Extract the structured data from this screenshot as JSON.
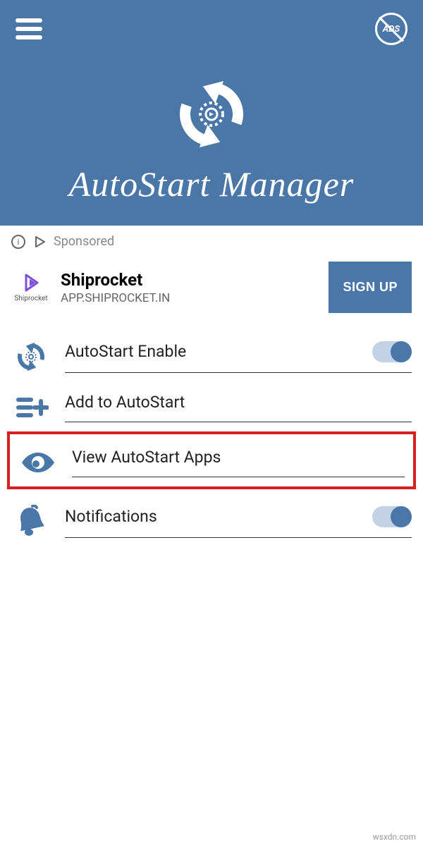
{
  "header": {
    "app_title": "AutoStart Manager",
    "ads_badge": "ADS"
  },
  "sponsored": {
    "label": "Sponsored"
  },
  "ad": {
    "title": "Shiprocket",
    "url": "APP.SHIPROCKET.IN",
    "icon_label": "Shiprocket",
    "cta": "SIGN UP"
  },
  "menu": {
    "items": [
      {
        "label": "AutoStart Enable",
        "toggle": true,
        "toggle_on": true,
        "icon": "refresh-gear"
      },
      {
        "label": "Add to AutoStart",
        "toggle": false,
        "icon": "list-plus"
      },
      {
        "label": "View AutoStart Apps",
        "toggle": false,
        "icon": "eye",
        "highlighted": true
      },
      {
        "label": "Notifications",
        "toggle": true,
        "toggle_on": true,
        "icon": "bell"
      }
    ]
  },
  "colors": {
    "primary": "#4a76a8",
    "highlight": "#d92020"
  },
  "watermark": "wsxdn.com"
}
